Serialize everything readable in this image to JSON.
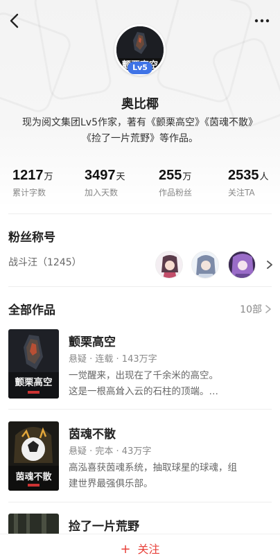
{
  "header": {
    "back_icon": "chevron-left-icon",
    "more_icon": "more-horizontal-icon"
  },
  "author": {
    "name": "奥比椰",
    "level": "Lv5",
    "bio": "现为阅文集团Lv5作家，著有《颤栗高空》《茵魂不散》《捡了一片荒野》等作品。"
  },
  "stats": [
    {
      "value": "1217",
      "unit": "万",
      "label": "累计字数"
    },
    {
      "value": "3497",
      "unit": "天",
      "label": "加入天数"
    },
    {
      "value": "255",
      "unit": "万",
      "label": "作品粉丝"
    },
    {
      "value": "2535",
      "unit": "人",
      "label": "关注TA"
    }
  ],
  "fans": {
    "title": "粉丝称号",
    "rank_text": "战斗汪（1245）",
    "avatars": [
      "fan-avatar-1",
      "fan-avatar-2",
      "fan-avatar-3"
    ]
  },
  "works": {
    "title": "全部作品",
    "count": "10部",
    "books": [
      {
        "title": "颤栗高空",
        "meta": "悬疑 · 连载 · 143万字",
        "desc1": "一觉醒来，出现在了千余米的高空。",
        "desc2": "这是一根高耸入云的石柱的顶端。…",
        "cover_text": "颤栗高空"
      },
      {
        "title": "茵魂不散",
        "meta": "悬疑 · 完本 · 43万字",
        "desc1": "高泓喜获茵魂系统，抽取球星的球魂，组",
        "desc2": "建世界最强俱乐部。",
        "cover_text": "茵魂不散"
      },
      {
        "title": "捡了一片荒野",
        "meta": "",
        "desc1": "",
        "desc2": "",
        "cover_text": ""
      }
    ]
  },
  "follow": {
    "plus": "+",
    "label": "关注"
  },
  "colors": {
    "accent_red": "#e8413a",
    "level_blue": "#3f73e6"
  }
}
